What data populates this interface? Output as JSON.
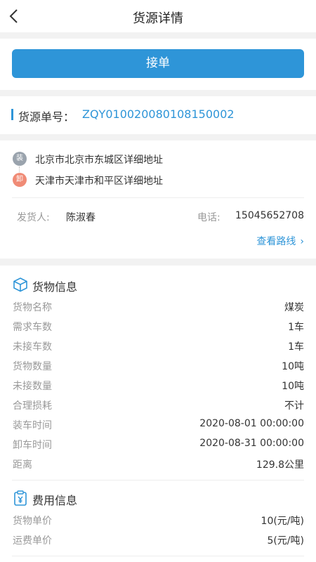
{
  "header": {
    "title": "货源详情",
    "back_icon": "chevron-left-icon"
  },
  "accept_button": {
    "label": "接单",
    "color": "#2e95d8"
  },
  "order": {
    "label": "货源单号：",
    "number": "ZQY010020080108150002"
  },
  "route": {
    "load_badge": "装",
    "unload_badge": "卸",
    "load_address": "北京市北京市东城区详细地址",
    "unload_address": "天津市天津市和平区详细地址",
    "sender_label": "发货人:",
    "sender_name": "陈淑春",
    "phone_label": "电话:",
    "phone": "15045652708",
    "view_route": "查看路线",
    "view_route_chevron": "›"
  },
  "goods": {
    "title": "货物信息",
    "rows": [
      {
        "key": "货物名称",
        "value": "煤炭"
      },
      {
        "key": "需求车数",
        "value": "1车"
      },
      {
        "key": "未接车数",
        "value": "1车"
      },
      {
        "key": "货物数量",
        "value": "10吨"
      },
      {
        "key": "未接数量",
        "value": "10吨"
      },
      {
        "key": "合理损耗",
        "value": "不计"
      },
      {
        "key": "装车时间",
        "value": "2020-08-01 00:00:00"
      },
      {
        "key": "卸车时间",
        "value": "2020-08-31 00:00:00"
      },
      {
        "key": "距离",
        "value": "129.8公里"
      }
    ]
  },
  "fees": {
    "title": "费用信息",
    "rows": [
      {
        "key": "货物单价",
        "value": "10(元/吨)"
      },
      {
        "key": "运费单价",
        "value": "5(元/吨)"
      }
    ]
  }
}
